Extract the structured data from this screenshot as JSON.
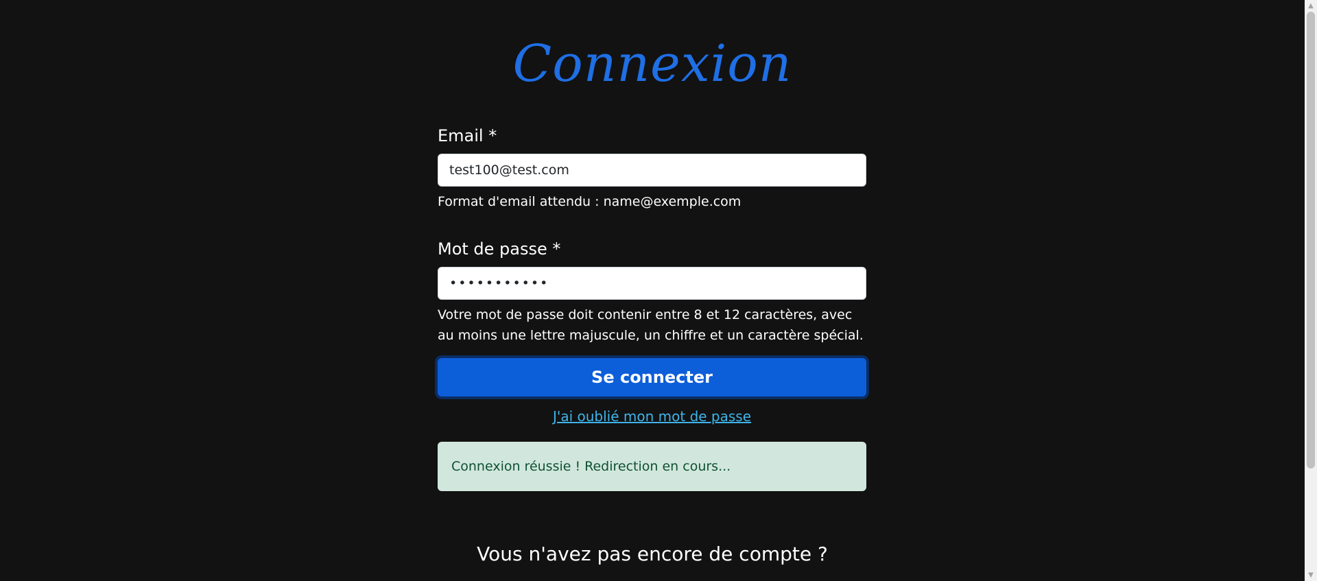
{
  "page": {
    "title": "Connexion"
  },
  "form": {
    "email": {
      "label": "Email *",
      "value": "test100@test.com",
      "help": "Format d'email attendu : name@exemple.com"
    },
    "password": {
      "label": "Mot de passe *",
      "value": "•••••••••••",
      "help": "Votre mot de passe doit contenir entre 8 et 12 caractères, avec au moins une lettre majuscule, un chiffre et un caractère spécial."
    },
    "submit_label": "Se connecter",
    "forgot_link": "J'ai oublié mon mot de passe"
  },
  "alert": {
    "text": "Connexion réussie ! Redirection en cours..."
  },
  "footer": {
    "no_account": "Vous n'avez pas encore de compte ?"
  },
  "colors": {
    "background": "#121212",
    "title": "#1f6fe5",
    "button": "#0d5ed9",
    "link": "#3fb4ea",
    "alert_bg": "#d1e7dd",
    "alert_text": "#0f5132"
  },
  "icons": {
    "scroll_up": "triangle-up-icon",
    "scroll_down": "triangle-down-icon"
  }
}
